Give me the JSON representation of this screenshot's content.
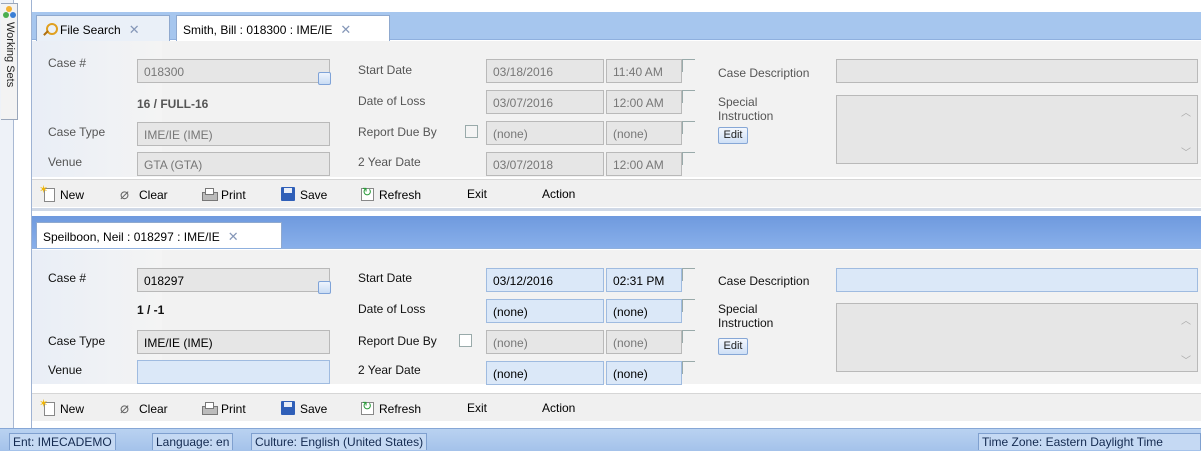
{
  "sidebar": {
    "working_sets_label": "Working Sets"
  },
  "top_tabs": [
    {
      "label": "File Search",
      "close": "✕"
    },
    {
      "label": "Smith, Bill : 018300 : IME/IE",
      "close": "✕"
    }
  ],
  "case1": {
    "case_no_label": "Case #",
    "case_no": "018300",
    "count_text": "16 / FULL-16",
    "case_type_label": "Case Type",
    "case_type": "IME/IE (IME)",
    "venue_label": "Venue",
    "venue": "GTA (GTA)",
    "start_date_label": "Start Date",
    "start_date": "03/18/2016",
    "start_time": "11:40 AM",
    "date_of_loss_label": "Date of Loss",
    "date_of_loss": "03/07/2016",
    "date_of_loss_time": "12:00 AM",
    "report_due_label": "Report Due By",
    "report_due": "(none)",
    "report_due_time": "(none)",
    "two_year_label": "2 Year Date",
    "two_year": "03/07/2018",
    "two_year_time": "12:00 AM",
    "case_desc_label": "Case Description",
    "special_label": "Special Instruction",
    "edit_label": "Edit"
  },
  "toolbar": {
    "new": "New",
    "clear": "Clear",
    "print": "Print",
    "save": "Save",
    "refresh": "Refresh",
    "exit": "Exit",
    "action": "Action"
  },
  "bottom_tab": {
    "label": "Speilboon, Neil : 018297 : IME/IE",
    "close": "✕"
  },
  "case2": {
    "case_no_label": "Case #",
    "case_no": "018297",
    "count_text": "1 / -1",
    "case_type_label": "Case Type",
    "case_type": "IME/IE (IME)",
    "venue_label": "Venue",
    "venue": "",
    "start_date_label": "Start Date",
    "start_date": "03/12/2016",
    "start_time": "02:31 PM",
    "date_of_loss_label": "Date of Loss",
    "date_of_loss": "(none)",
    "date_of_loss_time": "(none)",
    "report_due_label": "Report Due By",
    "report_due": "(none)",
    "report_due_time": "(none)",
    "two_year_label": "2 Year Date",
    "two_year": "(none)",
    "two_year_time": "(none)",
    "case_desc_label": "Case Description",
    "special_label": "Special Instruction",
    "edit_label": "Edit"
  },
  "statusbar": {
    "ent": "Ent: IMECADEMO",
    "language": "Language: en",
    "culture": "Culture: English (United States)",
    "timezone": "Time Zone: Eastern Daylight Time"
  },
  "icons": [
    "search-icon",
    "close-icon",
    "new-icon",
    "clear-icon",
    "print-icon",
    "save-icon",
    "refresh-icon",
    "working-sets-logo-icon"
  ]
}
